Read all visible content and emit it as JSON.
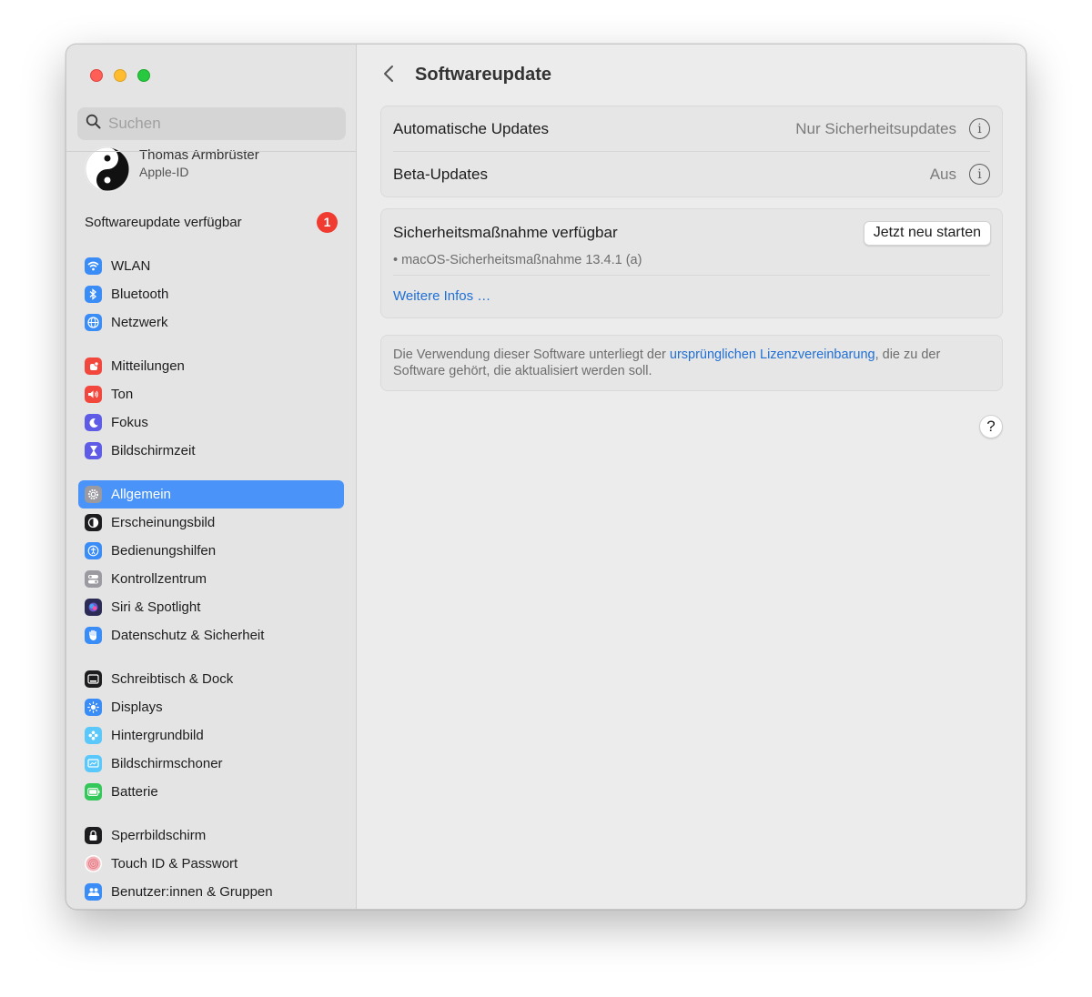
{
  "search": {
    "placeholder": "Suchen"
  },
  "profile": {
    "name": "Thomas Armbrüster",
    "subtitle": "Apple-ID"
  },
  "update_notice": {
    "label": "Softwareupdate verfügbar",
    "badge": "1"
  },
  "sidebar": {
    "items": [
      {
        "label": "WLAN",
        "icon": "wifi-icon",
        "color": "#3a8cf6"
      },
      {
        "label": "Bluetooth",
        "icon": "bluetooth-icon",
        "color": "#3a8cf6"
      },
      {
        "label": "Netzwerk",
        "icon": "globe-icon",
        "color": "#3a8cf6"
      },
      {
        "label": "Mitteilungen",
        "icon": "bell-icon",
        "color": "#f1473c"
      },
      {
        "label": "Ton",
        "icon": "speaker-icon",
        "color": "#f1473c"
      },
      {
        "label": "Fokus",
        "icon": "moon-icon",
        "color": "#5e5ce6"
      },
      {
        "label": "Bildschirmzeit",
        "icon": "hourglass-icon",
        "color": "#5e5ce6"
      },
      {
        "label": "Allgemein",
        "icon": "gear-icon",
        "color": "#8e8e93"
      },
      {
        "label": "Erscheinungsbild",
        "icon": "appearance-icon",
        "color": "#1d1d1f"
      },
      {
        "label": "Bedienungshilfen",
        "icon": "accessibility-icon",
        "color": "#3a8cf6"
      },
      {
        "label": "Kontrollzentrum",
        "icon": "control-center-icon",
        "color": "#8e8e93"
      },
      {
        "label": "Siri & Spotlight",
        "icon": "siri-icon",
        "color": "#3b3b7a"
      },
      {
        "label": "Datenschutz & Sicherheit",
        "icon": "hand-icon",
        "color": "#3a8cf6"
      },
      {
        "label": "Schreibtisch & Dock",
        "icon": "dock-icon",
        "color": "#1d1d1f"
      },
      {
        "label": "Displays",
        "icon": "sun-icon",
        "color": "#3a8cf6"
      },
      {
        "label": "Hintergrundbild",
        "icon": "flower-icon",
        "color": "#5ac8fa"
      },
      {
        "label": "Bildschirmschoner",
        "icon": "screensaver-icon",
        "color": "#5ac8fa"
      },
      {
        "label": "Batterie",
        "icon": "battery-icon",
        "color": "#34c759"
      },
      {
        "label": "Sperrbildschirm",
        "icon": "lock-icon",
        "color": "#1d1d1f"
      },
      {
        "label": "Touch ID & Passwort",
        "icon": "fingerprint-icon",
        "color": "#f2a0a8"
      },
      {
        "label": "Benutzer:innen & Gruppen",
        "icon": "users-icon",
        "color": "#3a8cf6"
      }
    ],
    "selected": "Allgemein"
  },
  "main": {
    "title": "Softwareupdate",
    "settings": {
      "auto_updates": {
        "label": "Automatische Updates",
        "value": "Nur Sicherheitsupdates"
      },
      "beta_updates": {
        "label": "Beta-Updates",
        "value": "Aus"
      }
    },
    "security": {
      "title": "Sicherheitsmaßnahme verfügbar",
      "button": "Jetzt neu starten",
      "item": "• macOS-Sicherheitsmaßnahme 13.4.1 (a)",
      "link": "Weitere Infos …"
    },
    "license": {
      "text_before": "Die Verwendung dieser Software unterliegt der ",
      "link": "ursprünglichen Lizenzvereinbarung",
      "text_after": ", die zu der Software gehört, die aktualisiert werden soll."
    },
    "help": "?"
  },
  "colors": {
    "accent": "#4a94f9",
    "link": "#1f6fd6",
    "badge": "#ef3b30"
  }
}
